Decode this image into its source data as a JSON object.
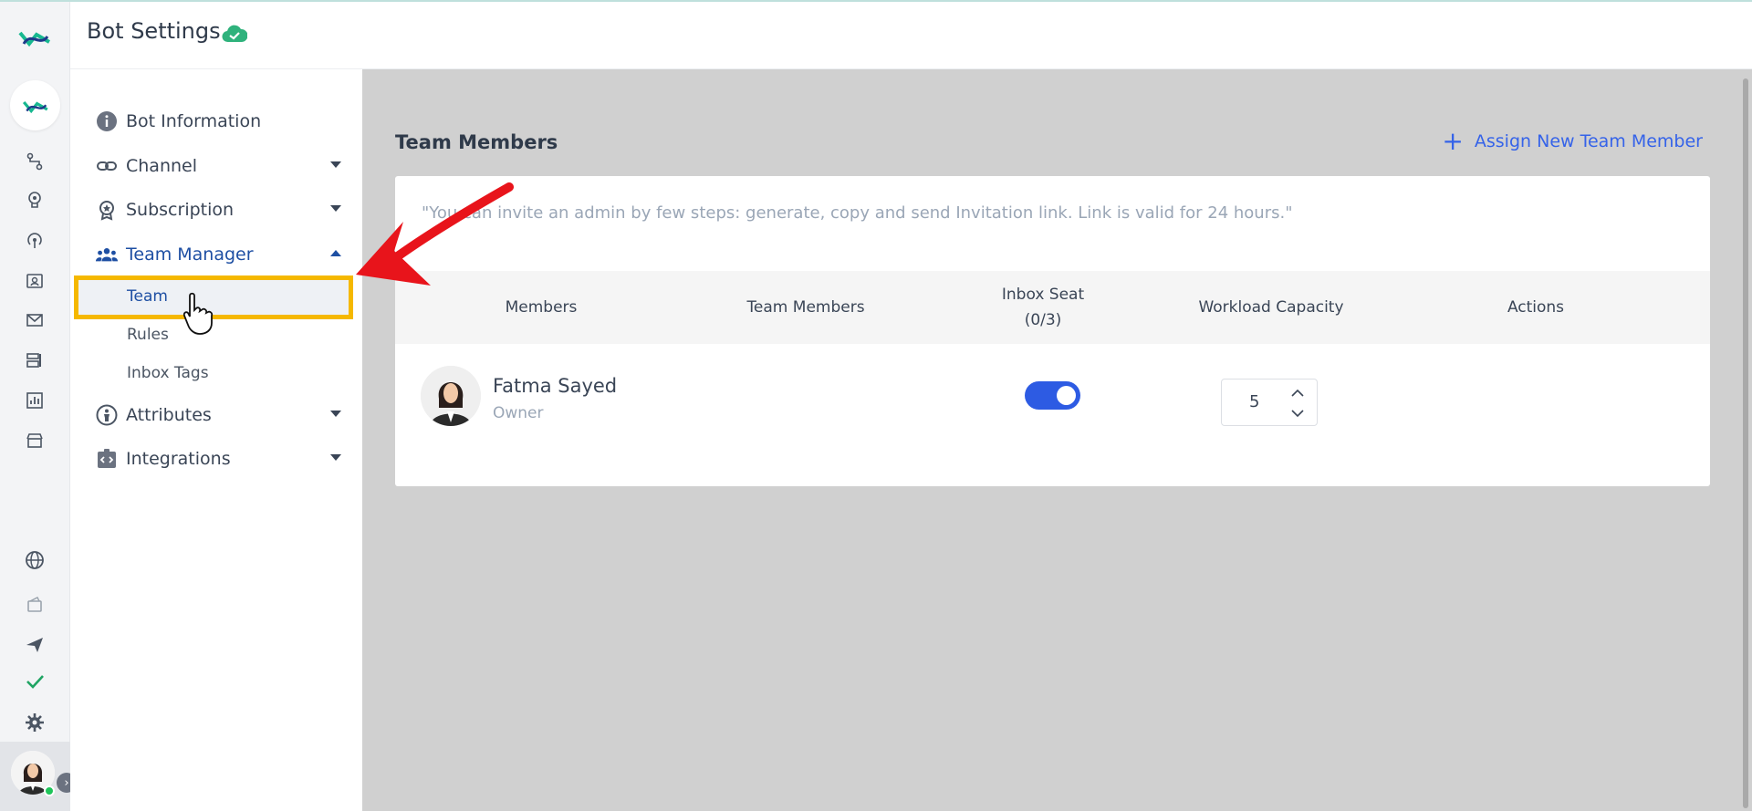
{
  "header": {
    "title": "Bot Settings"
  },
  "sidebar": {
    "items": [
      {
        "label": "Bot Information",
        "icon": "info-icon"
      },
      {
        "label": "Channel",
        "icon": "link-icon"
      },
      {
        "label": "Subscription",
        "icon": "award-icon"
      },
      {
        "label": "Team Manager",
        "icon": "users-icon"
      },
      {
        "label": "Attributes",
        "icon": "person-icon"
      },
      {
        "label": "Integrations",
        "icon": "code-icon"
      }
    ],
    "team_manager_sub": [
      "Team",
      "Rules",
      "Inbox Tags"
    ]
  },
  "main": {
    "section_title": "Team Members",
    "assign_label": "Assign New Team Member",
    "hint": "\"You can invite an admin by few steps: generate, copy and send Invitation link. Link is valid for 24 hours.\"",
    "columns": {
      "members": "Members",
      "team_members": "Team Members",
      "inbox_seat": "Inbox Seat",
      "inbox_seat_count": "(0/3)",
      "workload": "Workload Capacity",
      "actions": "Actions"
    },
    "member": {
      "name": "Fatma Sayed",
      "role": "Owner",
      "inbox_seat_enabled": true,
      "workload_capacity": "5"
    }
  },
  "colors": {
    "accent": "#1e4fa3",
    "link": "#3563e9",
    "highlight": "#f5b800",
    "annotation": "#e8141b",
    "toggle": "#2d5be3"
  }
}
